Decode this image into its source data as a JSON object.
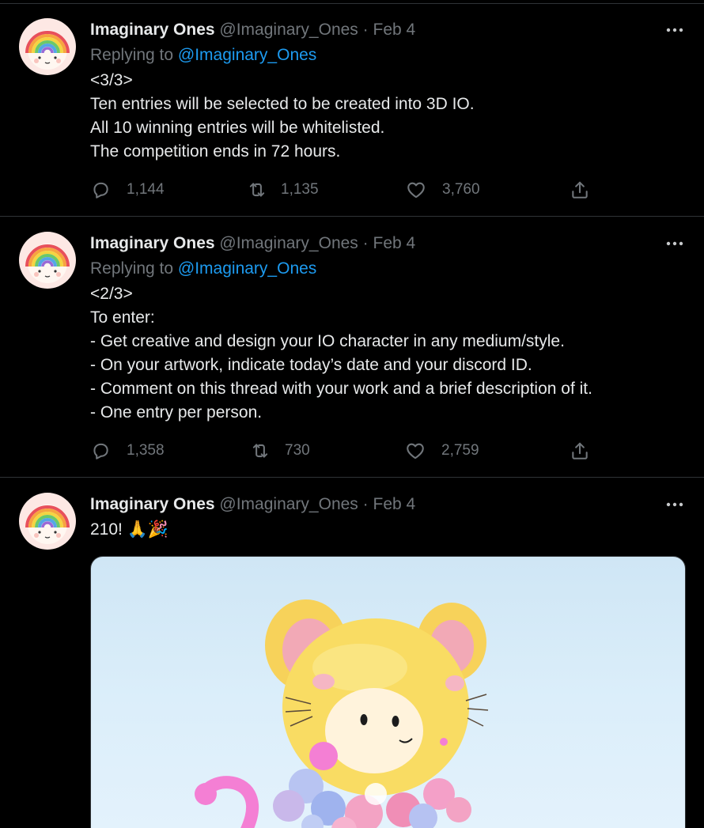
{
  "tweets": [
    {
      "author_name": "Imaginary Ones",
      "author_handle": "@Imaginary_Ones",
      "separator": "·",
      "date": "Feb 4",
      "replying_prefix": "Replying to",
      "replying_to": "@Imaginary_Ones",
      "lines": [
        "<3/3>",
        "Ten entries will be selected to be created into 3D IO.",
        "All 10 winning entries will be whitelisted.",
        "The competition ends in 72 hours."
      ],
      "replies": "1,144",
      "retweets": "1,135",
      "likes": "3,760"
    },
    {
      "author_name": "Imaginary Ones",
      "author_handle": "@Imaginary_Ones",
      "separator": "·",
      "date": "Feb 4",
      "replying_prefix": "Replying to",
      "replying_to": "@Imaginary_Ones",
      "lines": [
        "<2/3>",
        "To enter:",
        "- Get creative and design your IO character in any medium/style.",
        "- On your artwork, indicate today’s date and your discord ID.",
        "- Comment on this thread with your work and a brief description of it.",
        "- One entry per person."
      ],
      "replies": "1,358",
      "retweets": "730",
      "likes": "2,759"
    },
    {
      "author_name": "Imaginary Ones",
      "author_handle": "@Imaginary_Ones",
      "separator": "·",
      "date": "Feb 4",
      "lines": [
        "210! 🙏🎉"
      ]
    }
  ],
  "icons": {
    "more": "more-icon",
    "reply": "reply-icon",
    "retweet": "retweet-icon",
    "like": "like-icon",
    "share": "share-icon",
    "avatar": "rainbow-character-avatar"
  },
  "colors": {
    "background": "#000000",
    "link": "#1d9bf0",
    "secondary_text": "#71767b",
    "primary_text": "#e7e9ea",
    "divider": "#2f3336"
  }
}
